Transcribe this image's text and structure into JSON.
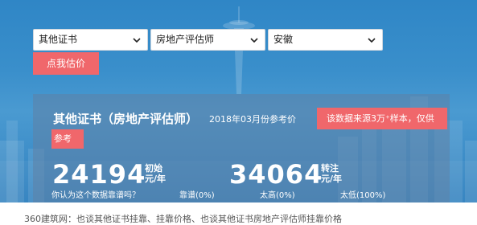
{
  "filters": {
    "certificate_type": "其他证书",
    "profession": "房地产评估师",
    "region": "安徽"
  },
  "estimate_button": "点我估价",
  "card": {
    "title": "其他证书（房地产评估师）",
    "date": "2018年03月份参考价",
    "note_part1": "该数据来源3万⁺样本，仅供",
    "note_part2": "参考",
    "initial_salary": "24194",
    "initial_label_line1": "初始",
    "initial_label_line2": "元/年",
    "transfer_salary": "34064",
    "transfer_label_line1": "转注",
    "transfer_label_line2": "元/年",
    "sub_info": "你认为这个数据靠谱吗？",
    "vote_accurate": "靠谱(0%)",
    "vote_low": "太高(0%)",
    "vote_high": "太低(100%)"
  },
  "breadcrumb_text": "360建筑网：也谈其他证书挂靠、挂靠价格、也谈其他证书房地产评估师挂靠价格",
  "colors": {
    "accent": "#f0676b",
    "hero_blue": "#3a8fcb"
  }
}
